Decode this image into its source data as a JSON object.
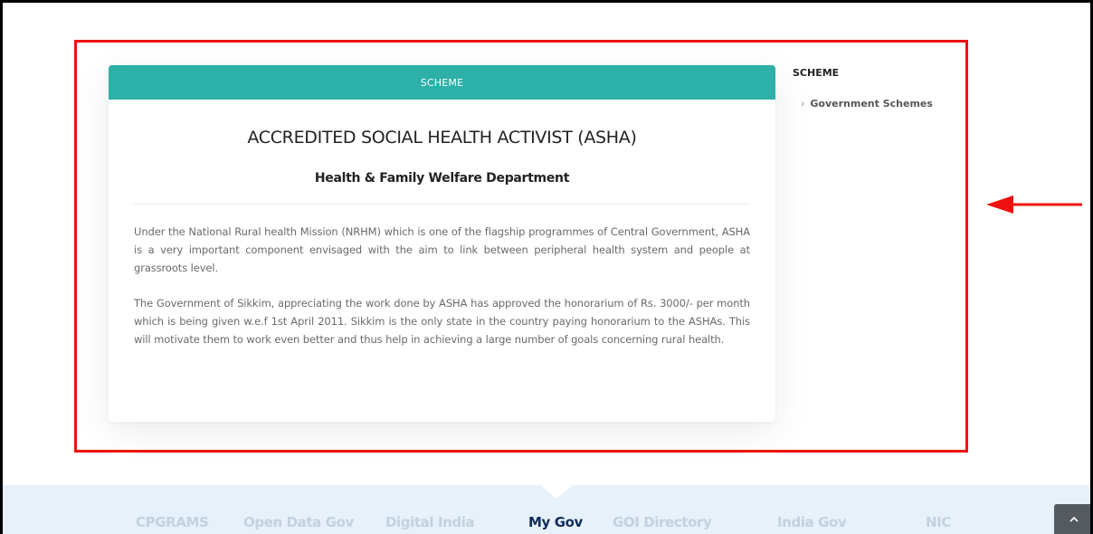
{
  "card": {
    "header": "SCHEME",
    "title": "ACCREDITED SOCIAL HEALTH ACTIVIST (ASHA)",
    "subtitle": "Health & Family Welfare Department",
    "paragraphs": [
      "Under the National Rural health Mission (NRHM) which is one of the flagship programmes of Central Government, ASHA is a very important component envisaged with the aim to link between peripheral health system and people at grassroots level.",
      "The Government of Sikkim, appreciating the work done by ASHA has approved the honorarium of Rs. 3000/- per month which is being given w.e.f 1st April 2011. Sikkim is the only state in the country paying honorarium to the ASHAs. This will motivate them to work even better and thus help in achieving a large number of goals concerning rural health."
    ]
  },
  "sidebar": {
    "heading": "SCHEME",
    "items": [
      {
        "label": "Government Schemes",
        "icon": "chevron-right-icon"
      }
    ]
  },
  "footer": {
    "links": [
      {
        "label": "CPGRAMS",
        "active": false
      },
      {
        "label": "Open Data Gov",
        "active": false
      },
      {
        "label": "Digital India",
        "active": false
      },
      {
        "label": "My Gov",
        "active": true
      },
      {
        "label": "GOI Directory",
        "active": false
      },
      {
        "label": "India Gov",
        "active": false
      },
      {
        "label": "NIC",
        "active": false
      }
    ]
  },
  "scroll_top_icon": "chevron-up-icon",
  "annotation": {
    "highlight_color": "#ee1111",
    "arrow_color": "#ee1111"
  },
  "colors": {
    "accent": "#2cb0a8",
    "footer_bg": "#e6f1fa",
    "footer_link": "#c3d2df",
    "footer_link_active": "#0f2d5a"
  }
}
